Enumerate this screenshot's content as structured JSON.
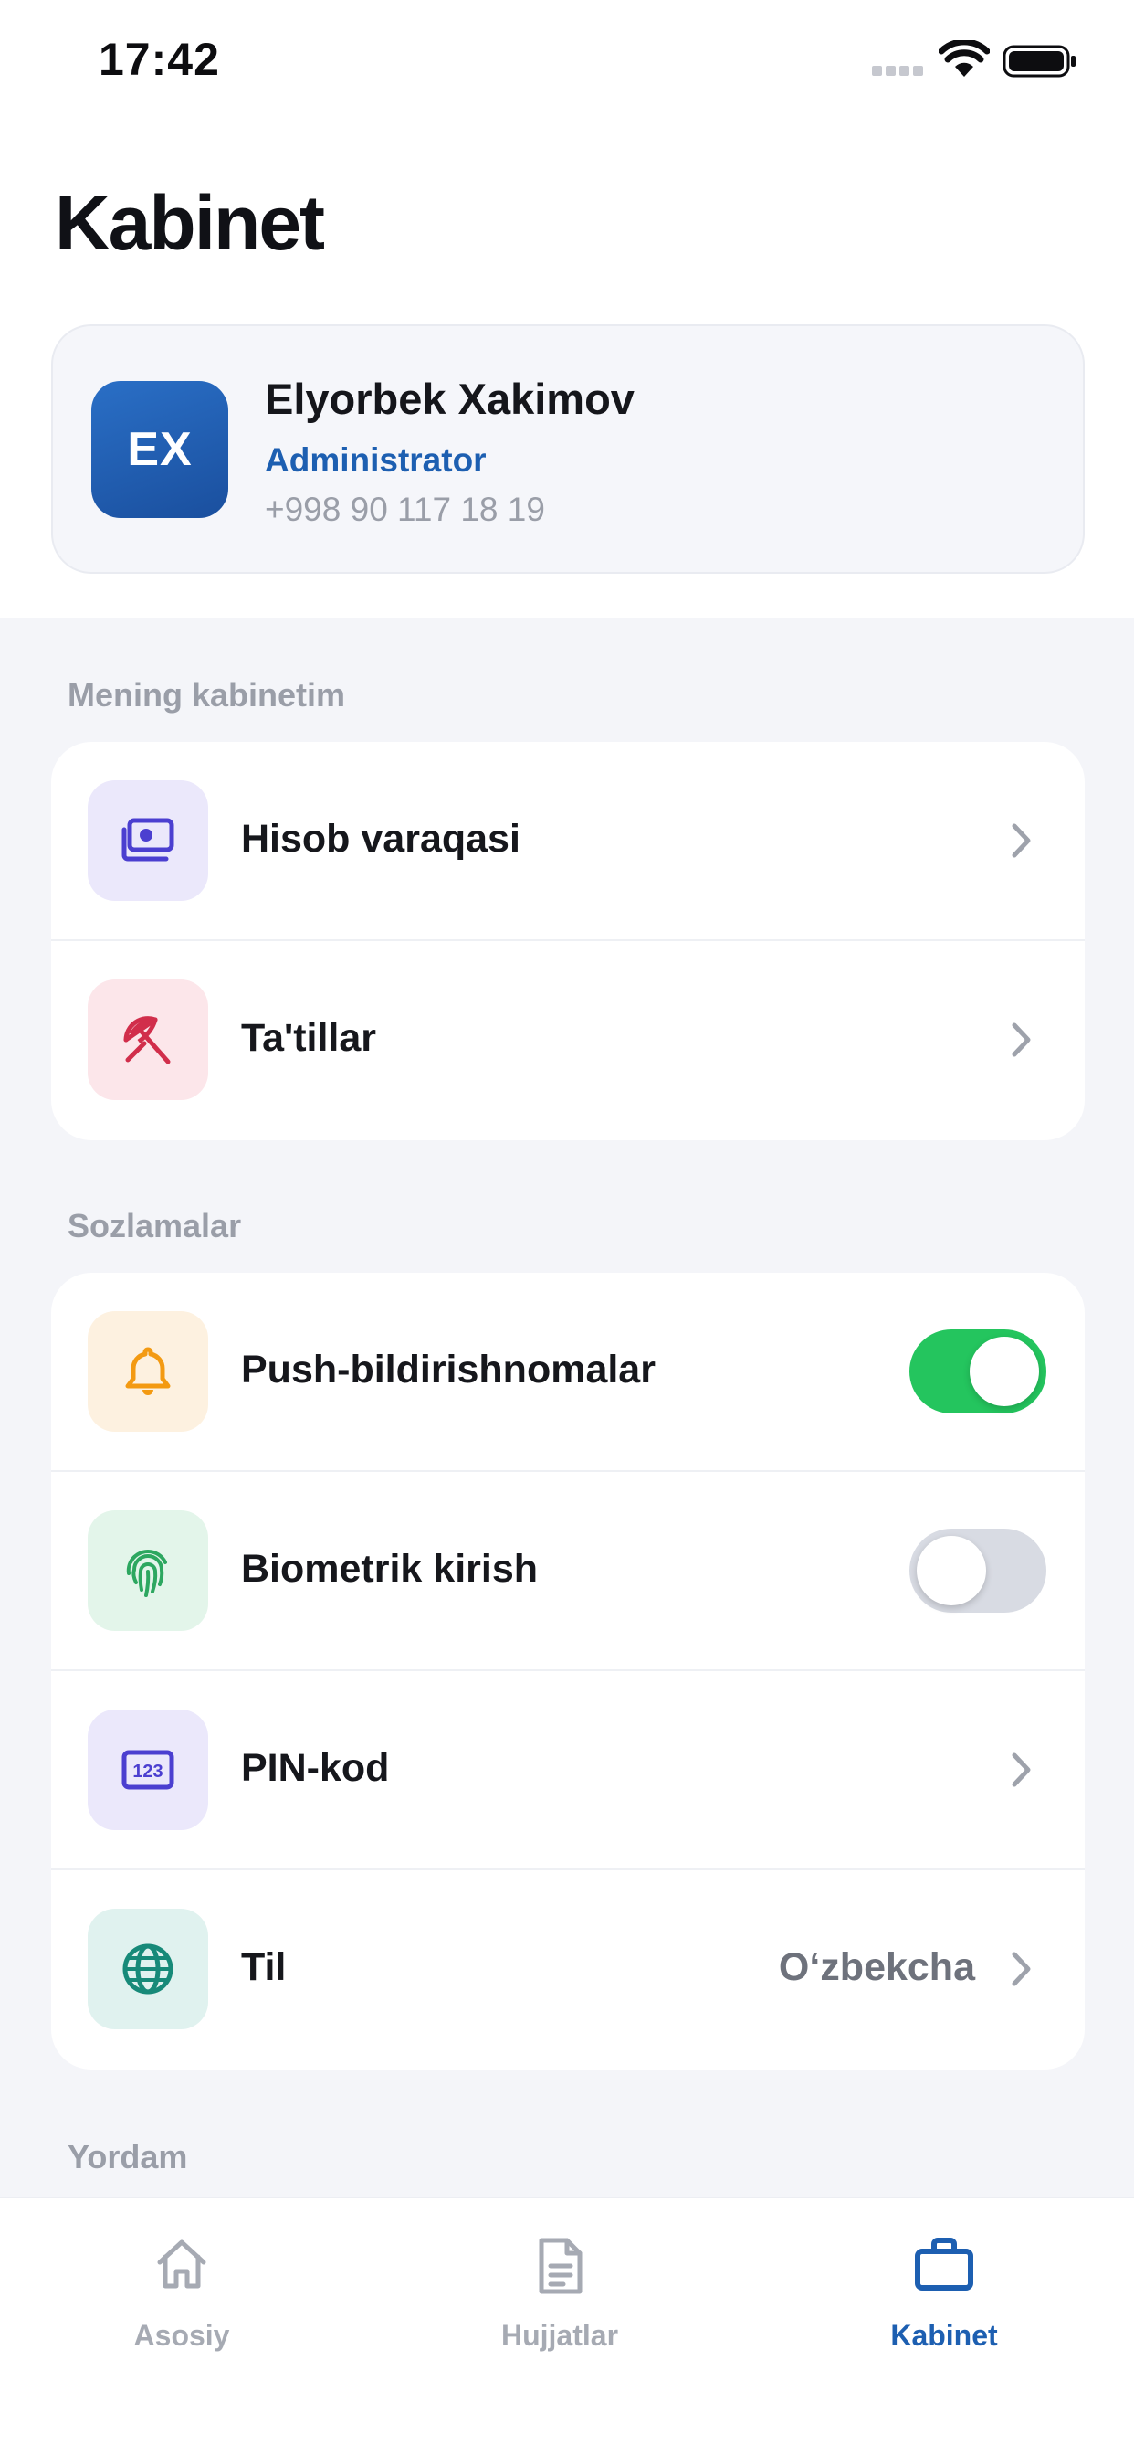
{
  "status_bar": {
    "time": "17:42"
  },
  "page": {
    "title": "Kabinet"
  },
  "profile": {
    "initials": "EX",
    "name": "Elyorbek Xakimov",
    "role": "Administrator",
    "phone": "+998 90 117 18 19"
  },
  "sections": {
    "cabinet": {
      "title": "Mening kabinetim",
      "items": [
        {
          "label": "Hisob varaqasi",
          "icon": "payslip-icon"
        },
        {
          "label": "Ta'tillar",
          "icon": "umbrella-icon"
        }
      ]
    },
    "settings": {
      "title": "Sozlamalar",
      "items": [
        {
          "label": "Push-bildirishnomalar",
          "icon": "bell-icon",
          "toggle": true
        },
        {
          "label": "Biometrik kirish",
          "icon": "fingerprint-icon",
          "toggle": false
        },
        {
          "label": "PIN-kod",
          "icon": "pin-code-icon"
        },
        {
          "label": "Til",
          "icon": "globe-icon",
          "value": "O‘zbekcha"
        }
      ]
    },
    "help": {
      "title": "Yordam"
    }
  },
  "tabbar": {
    "tabs": [
      {
        "label": "Asosiy",
        "icon": "home-icon"
      },
      {
        "label": "Hujjatlar",
        "icon": "document-icon"
      },
      {
        "label": "Kabinet",
        "icon": "briefcase-icon",
        "active": true
      }
    ]
  },
  "colors": {
    "accent": "#1d5fb1",
    "toggle_on": "#24c55e",
    "toggle_off": "#d8dbe3",
    "background": "#f4f5f9"
  }
}
